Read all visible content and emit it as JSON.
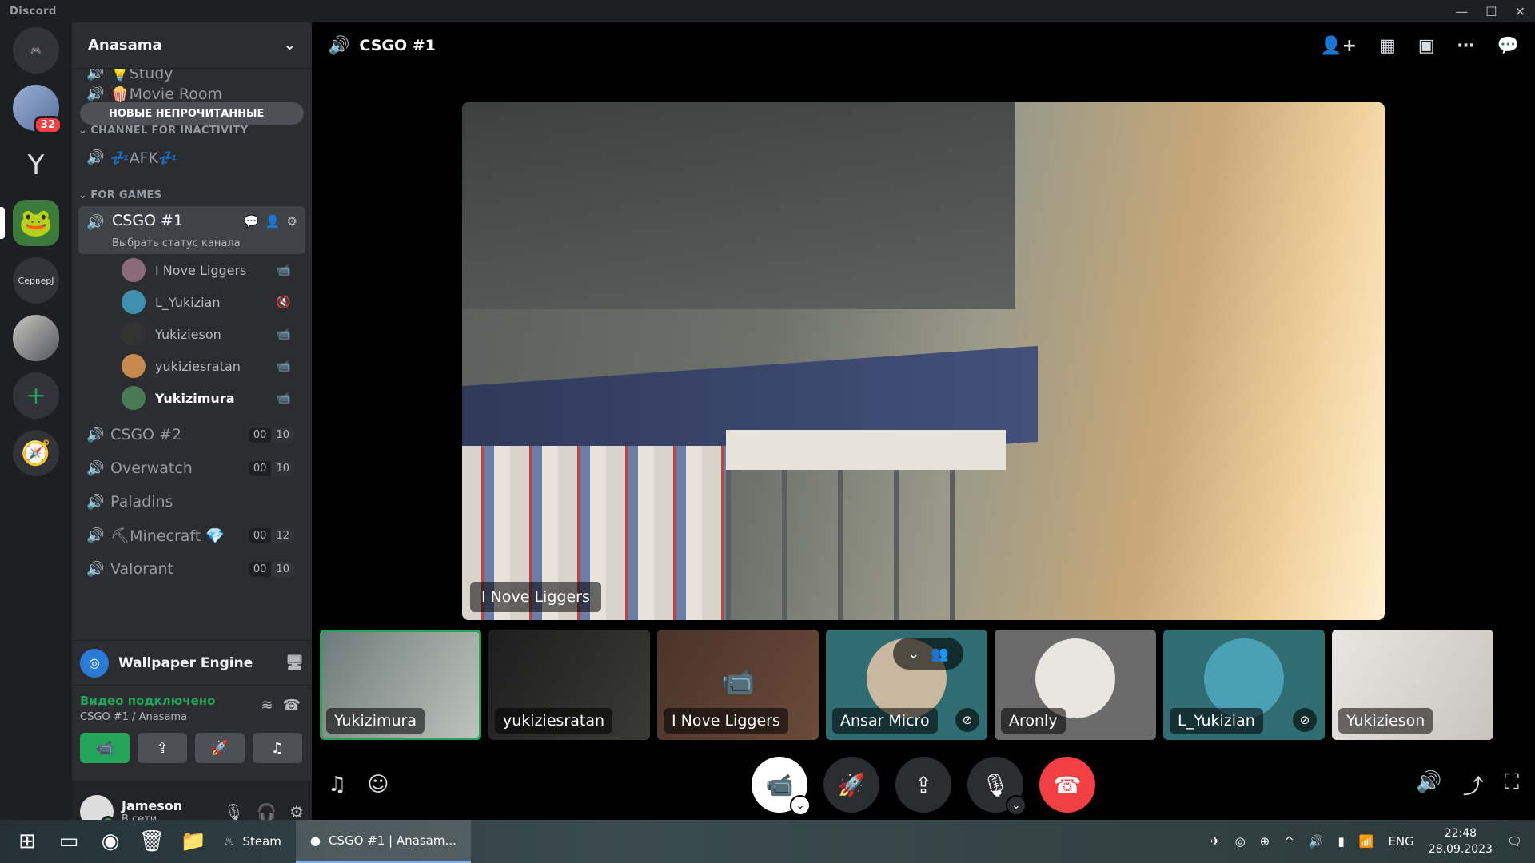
{
  "app": {
    "title": "Discord",
    "win_controls": [
      "—",
      "☐",
      "✕"
    ]
  },
  "guilds": [
    {
      "name": "home",
      "label": "🎮"
    },
    {
      "name": "server-1",
      "badge": "32"
    },
    {
      "name": "server-2",
      "label": "Y"
    },
    {
      "name": "server-3",
      "label": "🐸"
    },
    {
      "name": "server-4",
      "label": "СерверJ"
    },
    {
      "name": "server-5",
      "label": ""
    },
    {
      "name": "add-server",
      "label": "+"
    },
    {
      "name": "explore",
      "label": "🧭"
    }
  ],
  "server": {
    "name": "Anasama"
  },
  "unread_pill": "НОВЫЕ НЕПРОЧИТАННЫЕ",
  "channels_top": [
    {
      "name": "💡Study"
    },
    {
      "name": "🍿Movie Room"
    }
  ],
  "categories": {
    "inactivity": "CHANNEL FOR INACTIVITY",
    "games": "FOR GAMES"
  },
  "afk_channel": "💤AFK💤",
  "active_channel": {
    "name": "CSGO #1",
    "status": "Выбрать статус канала"
  },
  "members": [
    {
      "name": "I Nove Liggers",
      "icon": "📹",
      "color": "#8a6b7a"
    },
    {
      "name": "L_Yukizian",
      "icon": "🔇",
      "color": "#3f8fb0"
    },
    {
      "name": "Yukizieson",
      "icon": "📹",
      "color": "#333"
    },
    {
      "name": "yukiziesratan",
      "icon": "📹",
      "color": "#c58a4c"
    },
    {
      "name": "Yukizimura",
      "icon": "📹",
      "color": "#4a7a55",
      "bright": true
    }
  ],
  "game_channels": [
    {
      "name": "CSGO #2",
      "count": [
        "00",
        "10"
      ]
    },
    {
      "name": "Overwatch",
      "count": [
        "00",
        "10"
      ]
    },
    {
      "name": "Paladins",
      "count": null
    },
    {
      "name": "⛏Minecraft 💎",
      "count": [
        "00",
        "12"
      ]
    },
    {
      "name": "Valorant",
      "count": [
        "00",
        "10"
      ]
    }
  ],
  "activity": {
    "name": "Wallpaper Engine"
  },
  "voice": {
    "status": "Видео подключено",
    "location": "CSGO #1 / Anasama"
  },
  "user": {
    "name": "Jameson",
    "status": "В сети"
  },
  "topbar": {
    "channel": "CSGO #1"
  },
  "stage": {
    "label": "I Nove Liggers"
  },
  "tiles": [
    {
      "name": "Yukizimura",
      "bg": "linear-gradient(120deg,#6d7a78,#c0c4bf)",
      "selected": true
    },
    {
      "name": "yukiziesratan",
      "bg": "linear-gradient(120deg,#1d1e1d,#3a3a37)"
    },
    {
      "name": "I Nove Liggers",
      "bg": "linear-gradient(120deg,#4a3329,#6b4a3a)",
      "cam": true
    },
    {
      "name": "Ansar Micro",
      "bg": "#2f6d72",
      "face": "#c9b8a0",
      "muted": true,
      "ctrl": true
    },
    {
      "name": "Aronly",
      "bg": "#6b6b6b",
      "face": "#e9e6e1"
    },
    {
      "name": "L_Yukizian",
      "bg": "#2f6d72",
      "face": "#4aa0b5",
      "muted": true
    },
    {
      "name": "Yukizieson",
      "bg": "linear-gradient(120deg,#e8e6e2,#c8c4bd)"
    }
  ],
  "taskbar": {
    "tasks": [
      {
        "label": "Steam"
      },
      {
        "label": "CSGO #1 | Anasam..."
      }
    ],
    "lang": "ENG",
    "time": "22:48",
    "date": "28.09.2023"
  }
}
